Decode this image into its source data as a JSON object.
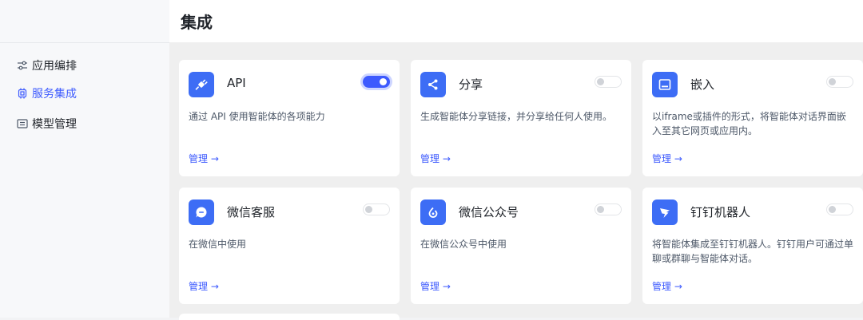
{
  "page": {
    "title": "集成"
  },
  "sidebar": {
    "items": [
      {
        "label": "应用编排",
        "icon": "sliders-icon",
        "active": false
      },
      {
        "label": "服务集成",
        "icon": "chip-icon",
        "active": true
      },
      {
        "label": "模型管理",
        "icon": "model-icon",
        "active": false
      }
    ]
  },
  "cards": [
    {
      "title": "API",
      "description": "通过 API 使用智能体的各项能力",
      "link": "管理 →",
      "enabled": true,
      "icon": "plug-icon"
    },
    {
      "title": "分享",
      "description": "生成智能体分享链接，并分享给任何人使用。",
      "link": "管理 →",
      "enabled": false,
      "icon": "share-icon"
    },
    {
      "title": "嵌入",
      "description": "以iframe或插件的形式，将智能体对话界面嵌入至其它网页或应用内。",
      "link": "管理 →",
      "enabled": false,
      "icon": "embed-icon"
    },
    {
      "title": "微信客服",
      "description": "在微信中使用",
      "link": "管理 →",
      "enabled": false,
      "icon": "chat-bubble-icon"
    },
    {
      "title": "微信公众号",
      "description": "在微信公众号中使用",
      "link": "管理 →",
      "enabled": false,
      "icon": "wechat-oa-icon"
    },
    {
      "title": "钉钉机器人",
      "description": "将智能体集成至钉钉机器人。钉钉用户可通过单聊或群聊与智能体对话。",
      "link": "管理 →",
      "enabled": false,
      "icon": "dingtalk-icon"
    }
  ],
  "colors": {
    "accent": "#3d5afe",
    "icon_bg": "#3d6df5"
  }
}
